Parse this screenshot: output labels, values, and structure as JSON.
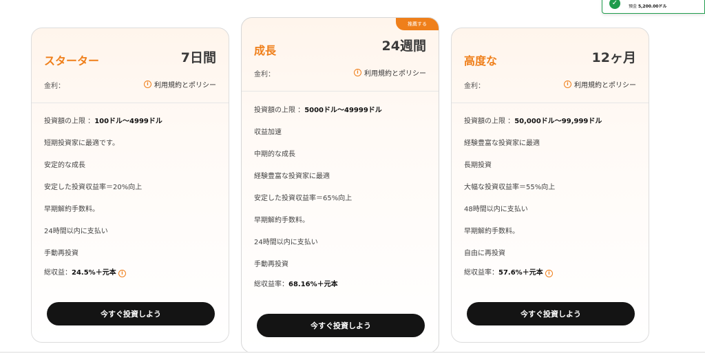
{
  "toast": {
    "text": "預金",
    "amount": "5,200.00ドル"
  },
  "plans": [
    {
      "title": "スターター",
      "duration": "7日間",
      "rate_label": "金利：",
      "terms_label": "利用規約とポリシー",
      "features": [
        {
          "prefix": "投資額の上限 ：",
          "bold": "100ドル〜4999ドル",
          "suffix": ""
        },
        {
          "prefix": "短期投資家に最適です。",
          "bold": "",
          "suffix": ""
        },
        {
          "prefix": "安定的な成長",
          "bold": "",
          "suffix": ""
        },
        {
          "prefix": "安定した投資収益率＝20%向上",
          "bold": "",
          "suffix": ""
        },
        {
          "prefix": "早期解約手数料。",
          "bold": "",
          "suffix": ""
        },
        {
          "prefix": "24時間以内に支払い",
          "bold": "",
          "suffix": ""
        },
        {
          "prefix": "手動再投資",
          "bold": "",
          "suffix": ""
        },
        {
          "prefix": "総収益：",
          "bold": "24.5%＋元本",
          "suffix": "",
          "info": true
        }
      ],
      "button": "今すぐ投資しよう"
    },
    {
      "title": "成長",
      "duration": "24週間",
      "badge": "推薦する",
      "rate_label": "金利：",
      "terms_label": "利用規約とポリシー",
      "features": [
        {
          "prefix": "投資額の上限 ：",
          "bold": "5000ドル〜49999ドル",
          "suffix": ""
        },
        {
          "prefix": "収益加速",
          "bold": "",
          "suffix": ""
        },
        {
          "prefix": "中期的な成長",
          "bold": "",
          "suffix": ""
        },
        {
          "prefix": "経験豊富な投資家に最適",
          "bold": "",
          "suffix": ""
        },
        {
          "prefix": "安定した投資収益率＝65%向上",
          "bold": "",
          "suffix": ""
        },
        {
          "prefix": "早期解約手数料。",
          "bold": "",
          "suffix": ""
        },
        {
          "prefix": "24時間以内に支払い",
          "bold": "",
          "suffix": ""
        },
        {
          "prefix": "手動再投資",
          "bold": "",
          "suffix": ""
        },
        {
          "prefix": "総収益率：",
          "bold": "68.16%＋元本",
          "suffix": ""
        }
      ],
      "button": "今すぐ投資しよう"
    },
    {
      "title": "高度な",
      "duration": "12ヶ月",
      "rate_label": "金利：",
      "terms_label": "利用規約とポリシー",
      "features": [
        {
          "prefix": "投資額の上限 ：",
          "bold": "50,000ドル〜99,999ドル",
          "suffix": ""
        },
        {
          "prefix": "経験豊富な投資家に最適",
          "bold": "",
          "suffix": ""
        },
        {
          "prefix": "長期投資",
          "bold": "",
          "suffix": ""
        },
        {
          "prefix": "大幅な投資収益率＝55%向上",
          "bold": "",
          "suffix": ""
        },
        {
          "prefix": "48時間以内に支払い",
          "bold": "",
          "suffix": ""
        },
        {
          "prefix": "早期解約手数料。",
          "bold": "",
          "suffix": ""
        },
        {
          "prefix": "自由に再投資",
          "bold": "",
          "suffix": ""
        },
        {
          "prefix": "総収益率：",
          "bold": "57.6%＋元本",
          "suffix": "",
          "info": true
        }
      ],
      "button": "今すぐ投資しよう"
    }
  ]
}
